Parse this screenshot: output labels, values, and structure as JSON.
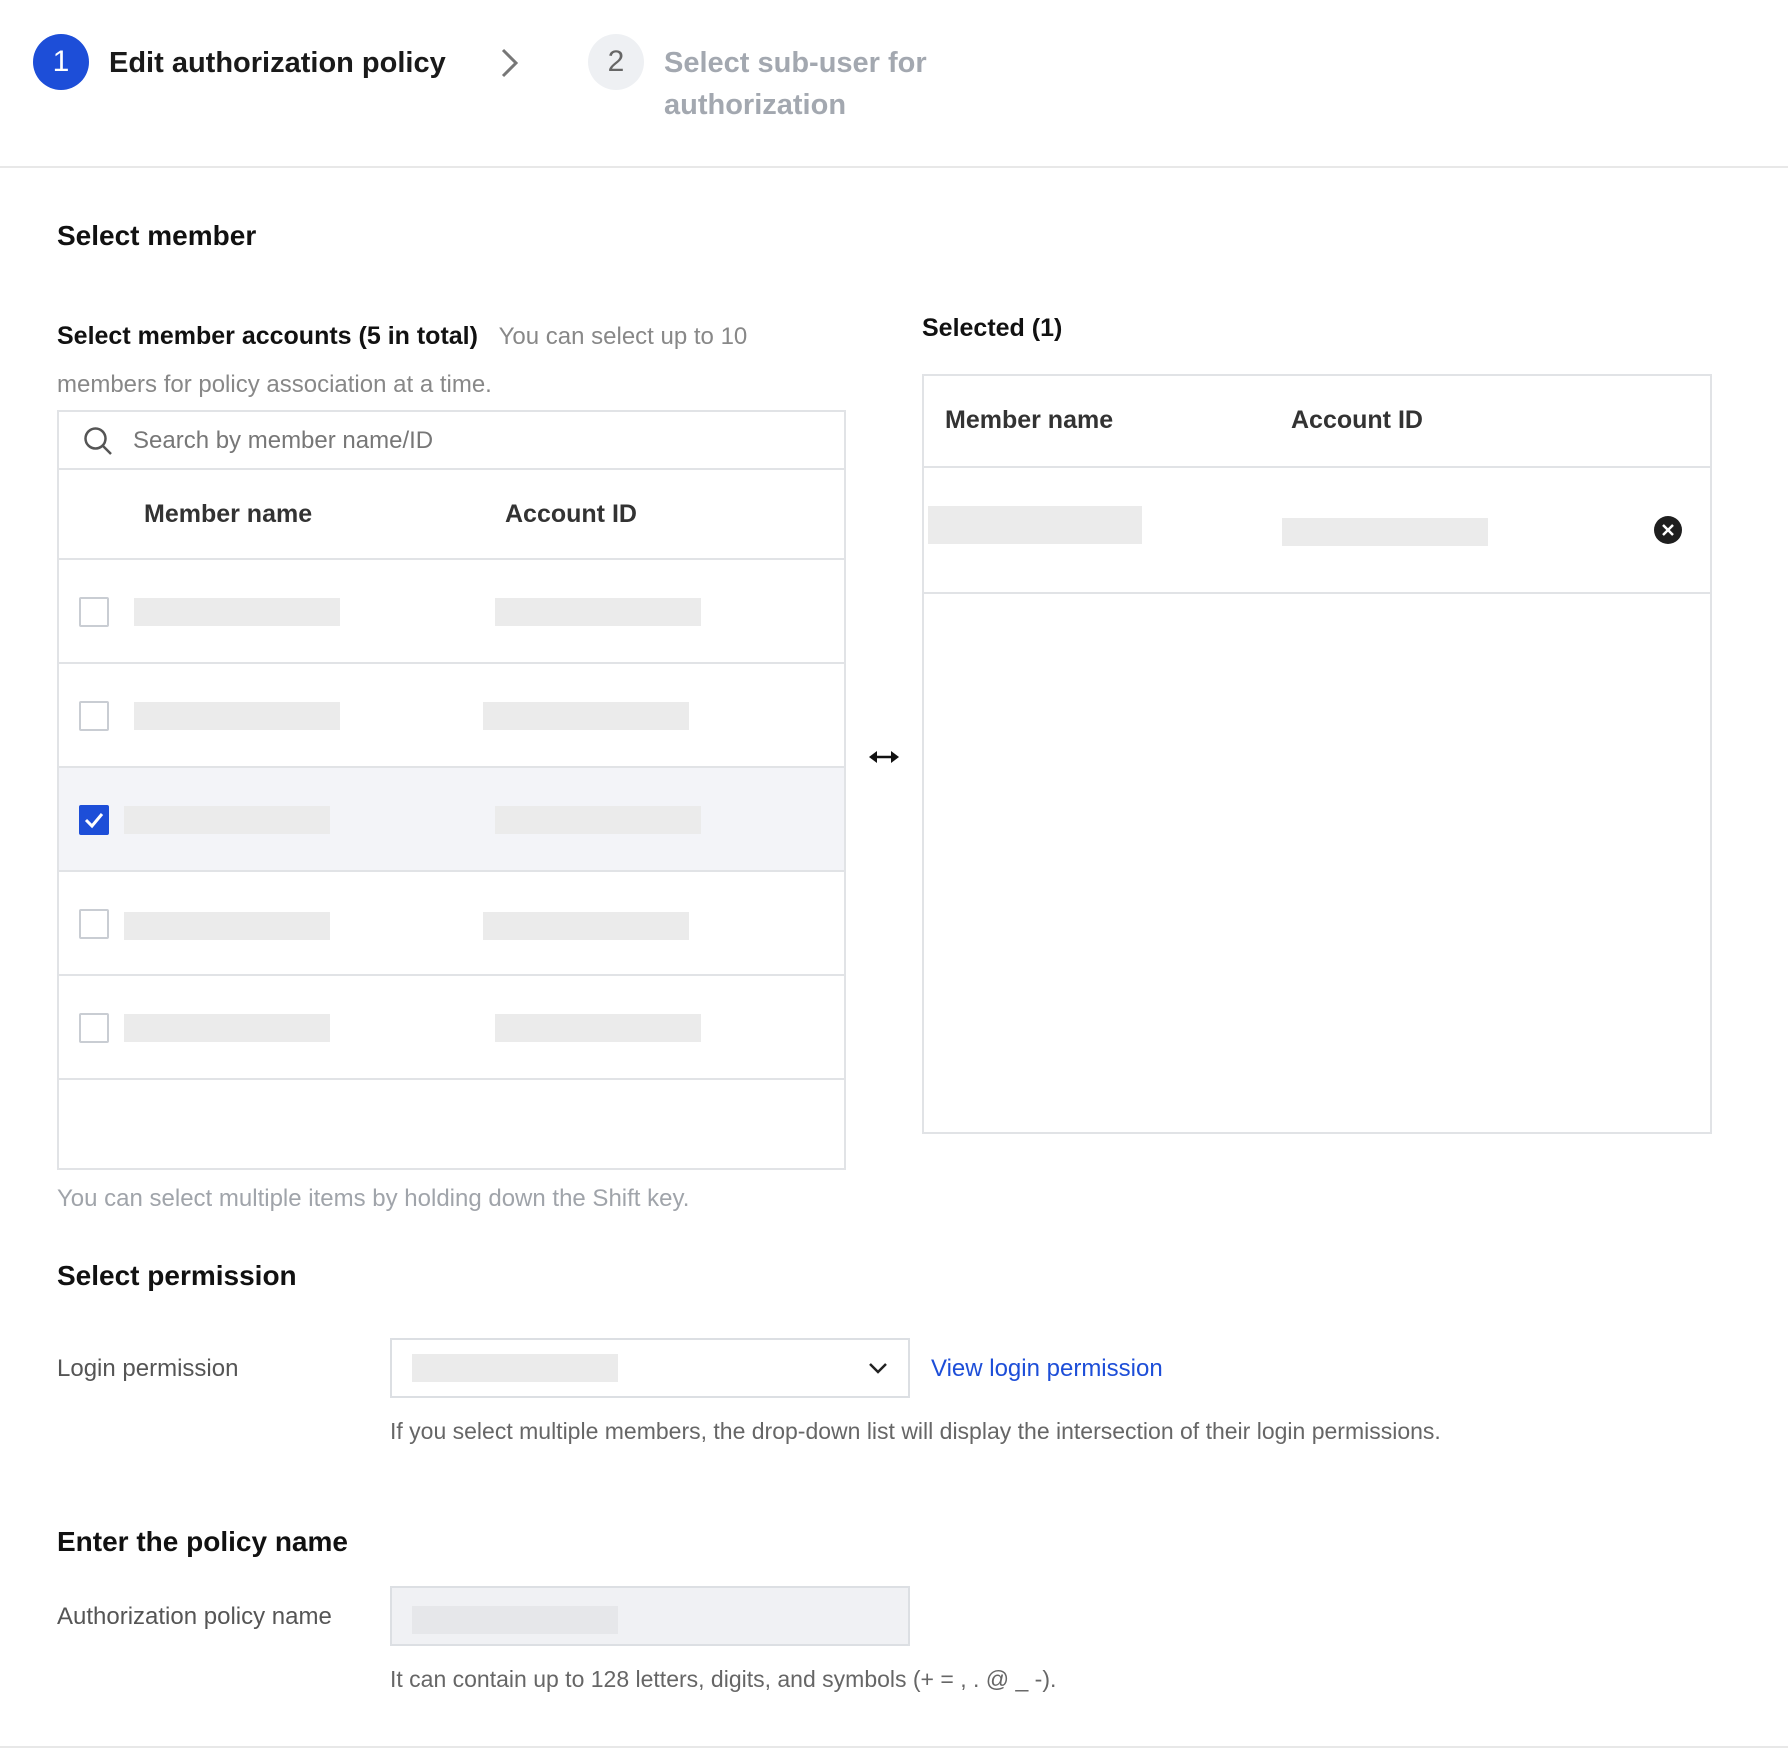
{
  "steps": [
    {
      "number": "1",
      "label": "Edit authorization policy",
      "state": "active"
    },
    {
      "number": "2",
      "label": "Select sub-user for authorization",
      "state": "inactive"
    }
  ],
  "select_member": {
    "section_title": "Select member",
    "accounts_title": "Select member accounts (5 in total)",
    "accounts_note": "You can select up to 10 members for policy association at a time.",
    "search_placeholder": "Search by member name/ID",
    "columns": [
      "Member name",
      "Account ID"
    ],
    "rows": [
      {
        "checked": false
      },
      {
        "checked": false
      },
      {
        "checked": true
      },
      {
        "checked": false
      },
      {
        "checked": false
      }
    ],
    "shift_hint": "You can select multiple items by holding down the Shift key.",
    "selected_title": "Selected (1)",
    "selected_columns": [
      "Member name",
      "Account ID"
    ]
  },
  "permission": {
    "section_title": "Select permission",
    "login_label": "Login permission",
    "view_link": "View login permission",
    "help": "If you select multiple members, the drop-down list will display the intersection of their login permissions."
  },
  "policy": {
    "section_title": "Enter the policy name",
    "name_label": "Authorization policy name",
    "help": "It can contain up to 128 letters, digits, and symbols (+ = , . @ _ -)."
  },
  "colors": {
    "accent": "#1d4ed8",
    "border": "#e1e3e6",
    "selected_row": "#f3f4f8"
  }
}
